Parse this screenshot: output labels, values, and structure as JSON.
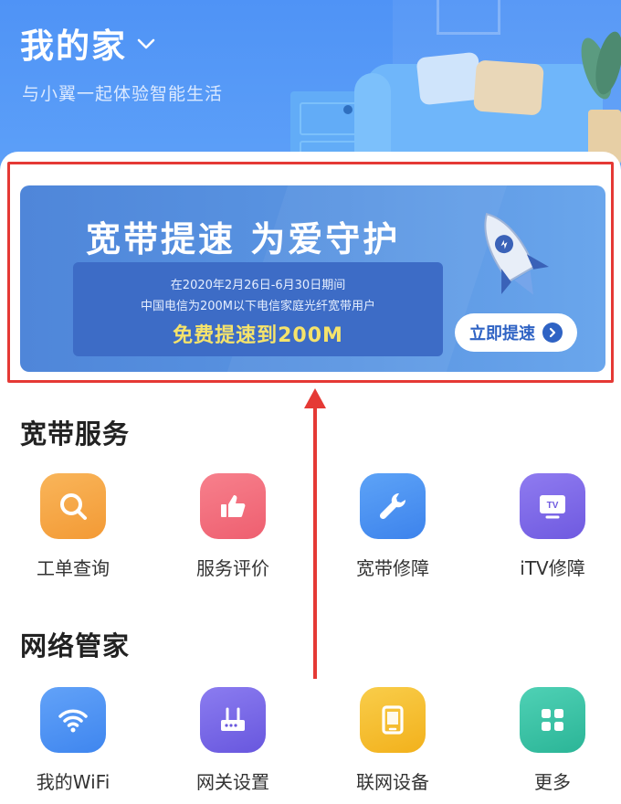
{
  "header": {
    "title": "我的家",
    "subtitle": "与小翼一起体验智能生活"
  },
  "banner": {
    "headline": "宽带提速  为爱守护",
    "line1": "在2020年2月26日-6月30日期间",
    "line2": "中国电信为200M以下电信家庭光纤宽带用户",
    "highlight": "免费提速到200M",
    "cta_label": "立即提速"
  },
  "broadband": {
    "title": "宽带服务",
    "items": [
      {
        "label": "工单查询",
        "icon": "search-icon",
        "color": "#f5a544"
      },
      {
        "label": "服务评价",
        "icon": "thumbs-up-icon",
        "color": "#f2707e"
      },
      {
        "label": "宽带修障",
        "icon": "wrench-icon",
        "color": "#4a90f0"
      },
      {
        "label": "iTV修障",
        "icon": "tv-icon",
        "color": "#8068e8"
      }
    ]
  },
  "network": {
    "title": "网络管家",
    "items": [
      {
        "label": "我的WiFi",
        "icon": "wifi-icon",
        "color": "#4e8ff2"
      },
      {
        "label": "网关设置",
        "icon": "router-icon",
        "color": "#7a6ae6"
      },
      {
        "label": "联网设备",
        "icon": "tablet-icon",
        "color": "#f5bf2f"
      },
      {
        "label": "更多",
        "icon": "grid-icon",
        "color": "#3cc2a8"
      }
    ]
  },
  "colors": {
    "header_blue": "#4f93f6",
    "highlight_red": "#e53935",
    "banner_blue": "#4f86d9"
  }
}
